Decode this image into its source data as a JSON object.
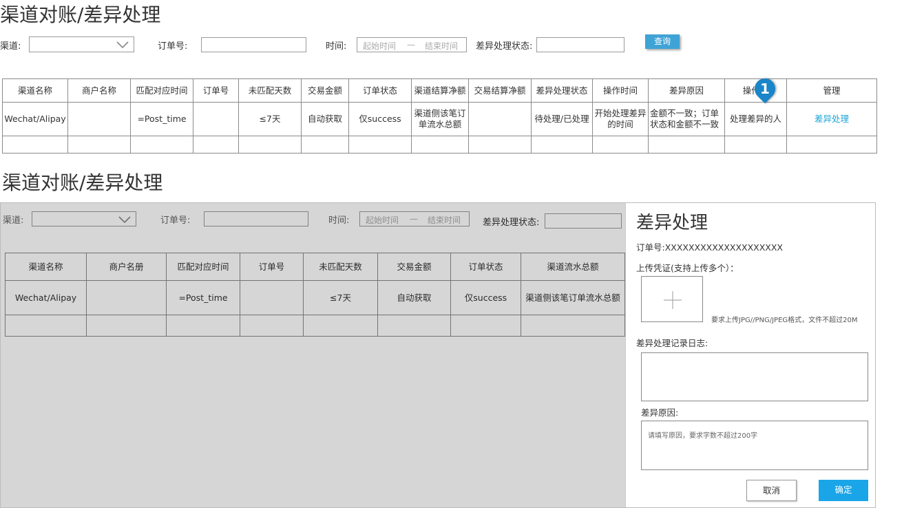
{
  "top": {
    "title": "渠道对账/差异处理",
    "filters": {
      "channel_label": "渠道:",
      "order_label": "订单号:",
      "time_label": "时间:",
      "start_placeholder": "起始时间",
      "dash": "—",
      "end_placeholder": "结束时间",
      "status_label": "差异处理状态:",
      "query_button": "查询"
    },
    "table": {
      "headers": [
        "渠道名称",
        "商户名称",
        "匹配对应时间",
        "订单号",
        "未匹配天数",
        "交易金额",
        "订单状态",
        "渠道结算净额",
        "交易结算净额",
        "差异处理状态",
        "操作时间",
        "差异原因",
        "操作人",
        "管理"
      ],
      "row": [
        "Wechat/Alipay",
        "",
        "=Post_time",
        "",
        "≤7天",
        "自动获取",
        "仅success",
        "渠道侧该笔订单流水总额",
        "",
        "待处理/已处理",
        "开始处理差异的时间",
        "金额不一致；订单状态和金额不一致",
        "处理差异的人",
        "差异处理"
      ]
    },
    "marker": "1"
  },
  "bottom": {
    "title": "渠道对账/差异处理",
    "filters": {
      "channel_label": "渠道:",
      "order_label": "订单号:",
      "time_label": "时间:",
      "start_placeholder": "起始时间",
      "dash": "—",
      "end_placeholder": "结束时间",
      "status_label": "差异处理状态:"
    },
    "table": {
      "headers": [
        "渠道名称",
        "商户名册",
        "匹配对应时间",
        "订单号",
        "未匹配天数",
        "交易金额",
        "订单状态",
        "渠道流水总额"
      ],
      "row": [
        "Wechat/Alipay",
        "",
        "=Post_time",
        "",
        "≤7天",
        "自动获取",
        "仅success",
        "渠道侧该笔订单流水总额"
      ]
    }
  },
  "panel": {
    "title": "差异处理",
    "order_label": "订单号:",
    "order_value": "XXXXXXXXXXXXXXXXXXXX",
    "upload_label": "上传凭证(支持上传多个）：",
    "upload_hint": "要求上传JPG//PNG/JPEG格式，文件不超过20M",
    "log_label": "差异处理记录日志:",
    "reason_label": "差异原因:",
    "reason_placeholder": "请填写原因，要求字数不超过200字",
    "cancel_button": "取消",
    "confirm_button": "确定"
  }
}
